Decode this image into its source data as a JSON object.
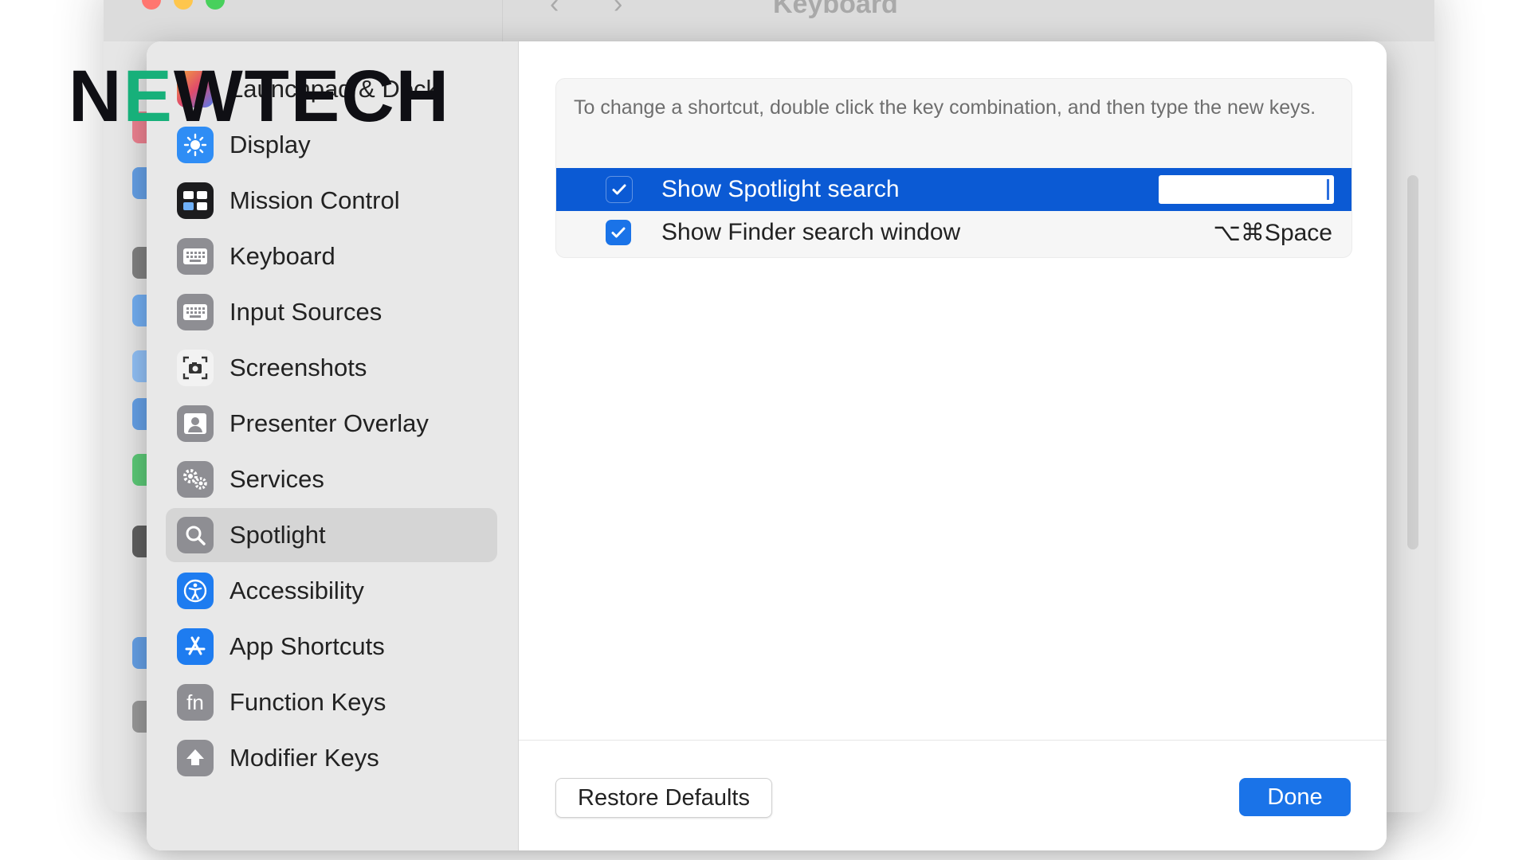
{
  "background_window": {
    "title": "Keyboard",
    "traffic_colors": [
      "#ff5f57",
      "#febc2e",
      "#28c840"
    ]
  },
  "watermark": {
    "text_before": "N",
    "text_e": "E",
    "text_after": "WTECH"
  },
  "sidebar": {
    "items": [
      {
        "label": "Launchpad & Dock",
        "icon": "launchpad-icon",
        "color": "#e85d3f"
      },
      {
        "label": "Display",
        "icon": "display-icon",
        "color": "#2f8df5"
      },
      {
        "label": "Mission Control",
        "icon": "mission-control-icon",
        "color": "#1c1c1e"
      },
      {
        "label": "Keyboard",
        "icon": "keyboard-icon",
        "color": "#8e8e93"
      },
      {
        "label": "Input Sources",
        "icon": "input-sources-icon",
        "color": "#8e8e93"
      },
      {
        "label": "Screenshots",
        "icon": "screenshots-icon",
        "color": "#f2f2f2"
      },
      {
        "label": "Presenter Overlay",
        "icon": "presenter-overlay-icon",
        "color": "#8e8e93"
      },
      {
        "label": "Services",
        "icon": "services-icon",
        "color": "#8e8e93"
      },
      {
        "label": "Spotlight",
        "icon": "spotlight-icon",
        "color": "#8e8e93",
        "selected": true
      },
      {
        "label": "Accessibility",
        "icon": "accessibility-icon",
        "color": "#1e7cf0"
      },
      {
        "label": "App Shortcuts",
        "icon": "app-shortcuts-icon",
        "color": "#1e7cf0"
      },
      {
        "label": "Function Keys",
        "icon": "function-keys-icon",
        "color": "#8e8e93"
      },
      {
        "label": "Modifier Keys",
        "icon": "modifier-keys-icon",
        "color": "#8e8e93"
      }
    ]
  },
  "main": {
    "instruction": "To change a shortcut, double click the key combination, and then type the new keys.",
    "shortcuts": [
      {
        "label": "Show Spotlight search",
        "checked": true,
        "shortcut": "",
        "editing": true
      },
      {
        "label": "Show Finder search window",
        "checked": true,
        "shortcut": "⌥⌘Space",
        "editing": false
      }
    ]
  },
  "footer": {
    "restore_label": "Restore Defaults",
    "done_label": "Done"
  },
  "colors": {
    "accent": "#1a73e8",
    "highlight": "#0b5ad4"
  }
}
